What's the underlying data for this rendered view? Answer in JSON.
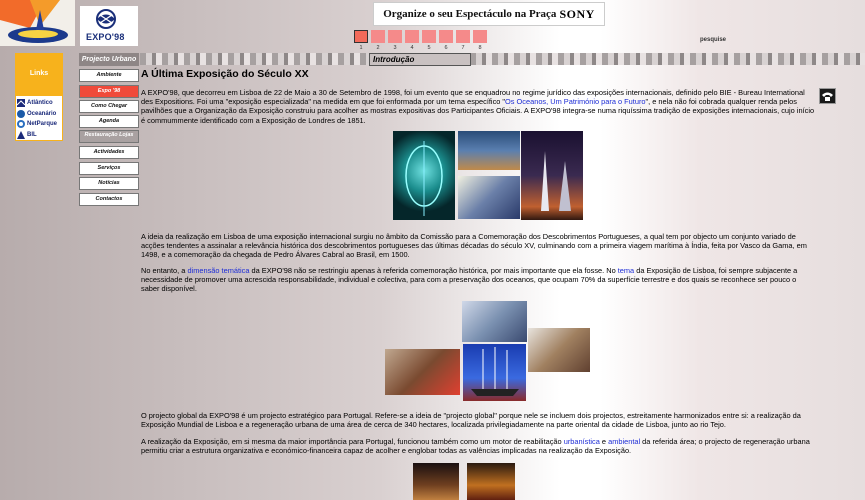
{
  "banner": {
    "text": "Organize o seu Espectáculo na Praça",
    "brand": "SONY"
  },
  "logo": {
    "text": "EXPO'98"
  },
  "steps": [
    "1",
    "2",
    "3",
    "4",
    "5",
    "6",
    "7",
    "8"
  ],
  "search_label": "pesquise",
  "section_label": "Introdução",
  "links": {
    "title": "Links",
    "items": [
      {
        "label": "Atlântico",
        "icon": "globe-icon"
      },
      {
        "label": "Oceanário",
        "icon": "wave-icon"
      },
      {
        "label": "NetParque",
        "icon": "network-icon"
      },
      {
        "label": "BIL",
        "icon": "bil-icon"
      }
    ]
  },
  "nav": {
    "header": "Projecto Urbano",
    "items": [
      {
        "label": "Ambiente",
        "state": "normal"
      },
      {
        "label": "Expo '98",
        "state": "active"
      },
      {
        "label": "Como Chegar",
        "state": "normal"
      },
      {
        "label": "Agenda",
        "state": "normal"
      },
      {
        "label": "Restauração Lojas",
        "state": "grey"
      },
      {
        "label": "Actividades",
        "state": "normal"
      },
      {
        "label": "Serviços",
        "state": "normal"
      },
      {
        "label": "Notícias",
        "state": "normal"
      },
      {
        "label": "Contactos",
        "state": "normal"
      }
    ]
  },
  "content": {
    "title": "A Última Exposição do Século XX",
    "p1_a": "A EXPO'98, que decorreu em Lisboa de 22 de Maio a 30 de Setembro de 1998, foi um evento que se enquadrou no regime jurídico das exposições internacionais, definido pelo BIE - Bureau International des Expositions. Foi uma \"exposição especializada\" na medida em que foi enformada por um tema específico \"",
    "p1_link": "Os Oceanos, Um Património para o Futuro",
    "p1_b": "\", e nela não foi cobrada qualquer renda pelos pavilhões que a Organização da Exposição construiu para acolher as mostras expositivas dos Participantes Oficiais. A EXPO'98 integra-se numa riquíssima tradição de exposições internacionais, cujo início é commummente identificado com a Exposição de Londres de 1851.",
    "p2": "A ideia da realização em Lisboa de uma exposição internacional surgiu no âmbito da Comissão para a Comemoração dos Descobrimentos Portugueses, a qual tem por objecto um conjunto variado de acções tendentes a assinalar a relevância histórica dos descobrimentos portugueses das últimas décadas do século XV, culminando com a primeira viagem marítima à Índia, feita por Vasco da Gama, em 1498, e a comemoração da chegada de Pedro Álvares Cabral ao Brasil, em 1500.",
    "p3_a": "No entanto, a ",
    "p3_link1": "dimensão temática",
    "p3_b": " da EXPO'98 não se restringiu apenas à referida comemoração histórica, por mais importante que ela fosse. No ",
    "p3_link2": "tema",
    "p3_c": " da Exposição de Lisboa, foi sempre subjacente a necessidade de promover uma acrescida responsabilidade, individual e colectiva, para com a preservação dos oceanos, que ocupam 70% da superfície terrestre e dos quais se reconhece ser pouco o saber disponível.",
    "p4": "O projecto global da EXPO'98 é um projecto estratégico para Portugal. Refere-se a ideia de \"projecto global\" porque nele se incluem dois projectos, estreitamente harmonizados entre si: a realização da Exposição Mundial de Lisboa e a regeneração urbana de uma área de cerca de 340 hectares, localizada privilegiadamente na parte oriental da cidade de Lisboa, junto ao rio Tejo.",
    "p5_a": "A realização da Exposição, em si mesma da maior importância para Portugal, funcionou também como um motor de reabilitação ",
    "p5_link1": "urbanística",
    "p5_b": " e ",
    "p5_link2": "ambiental",
    "p5_c": " da referida área; o projecto de regeneração urbana permitiu criar a estrutura organizativa e económico-financeira capaz de acolher e englobar todas as valências implicadas na realização da Exposição."
  },
  "colors": {
    "accent": "#f04a3a",
    "links_bg": "#f7b21c",
    "link_text": "#1d2dd6"
  }
}
